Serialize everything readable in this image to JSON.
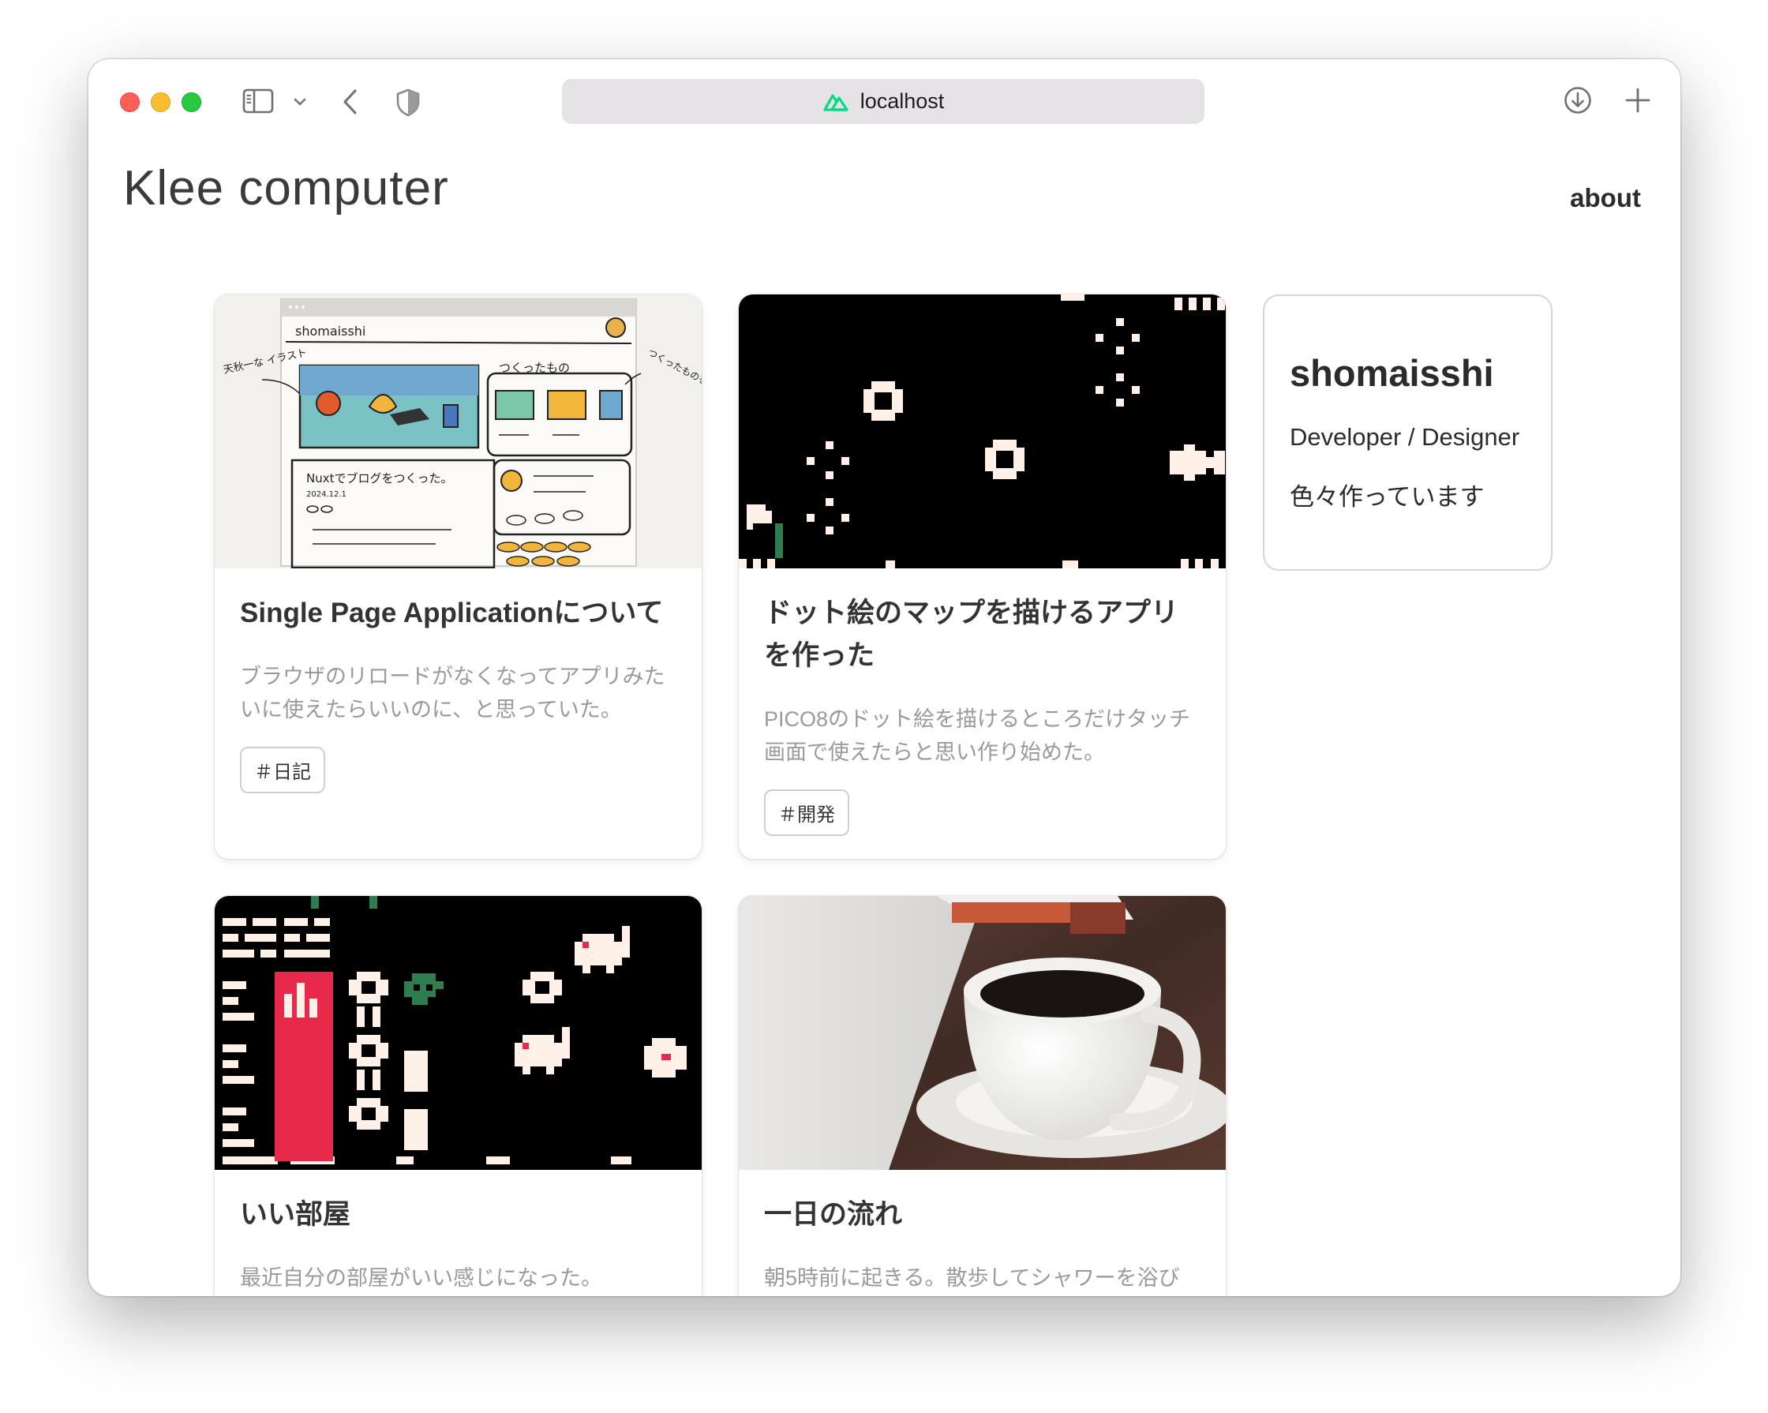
{
  "browser": {
    "url": "localhost"
  },
  "site": {
    "title": "Klee computer",
    "nav_about": "about"
  },
  "profile": {
    "name": "shomaisshi",
    "role": "Developer / Designer",
    "bio": "色々作っています"
  },
  "posts": [
    {
      "title": "Single Page Applicationについて",
      "description": "ブラウザのリロードがなくなってアプリみたいに使えたらいいのに、と思っていた。",
      "tag": "＃日記",
      "thumb_sketch": {
        "header": "shomaisshi",
        "note_left": "天秋一な イラスト",
        "note_mid": "つくったもの",
        "note_right": "つくったものを あるんだぞう でんてん",
        "post": "Nuxtでブログをつくった。",
        "date": "2024.12.1"
      }
    },
    {
      "title": "ドット絵のマップを描けるアプリを作った",
      "description": "PICO8のドット絵を描けるところだけタッチ画面で使えたらと思い作り始めた。",
      "tag": "＃開発"
    },
    {
      "title": "いい部屋",
      "description": "最近自分の部屋がいい感じになった。"
    },
    {
      "title": "一日の流れ",
      "description": "朝5時前に起きる。散歩してシャワーを浴び"
    }
  ],
  "colors": {
    "accent_red": "#e8294c",
    "accent_green": "#2f7d4f",
    "pixel_white": "#fff1e8",
    "nuxt_green": "#00dc82"
  }
}
